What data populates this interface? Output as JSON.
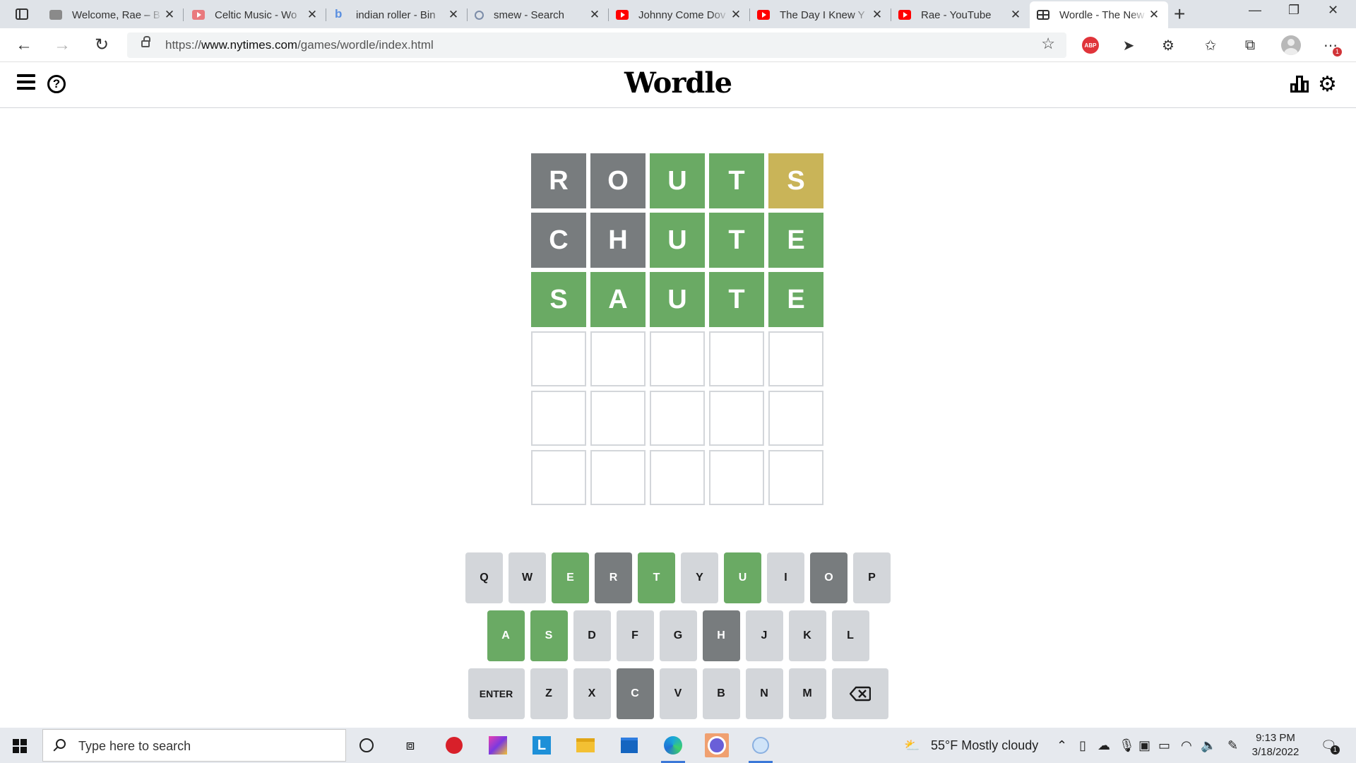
{
  "browser": {
    "tabs": [
      {
        "title": "Welcome, Rae – B",
        "favicon": "generic-site-icon"
      },
      {
        "title": "Celtic Music - Wo",
        "favicon": "youtube-icon"
      },
      {
        "title": "indian roller - Bin",
        "favicon": "bing-icon"
      },
      {
        "title": "smew - Search",
        "favicon": "search-icon"
      },
      {
        "title": "Johnny Come Dov",
        "favicon": "youtube-icon"
      },
      {
        "title": "The Day I Knew Y",
        "favicon": "youtube-icon"
      },
      {
        "title": "Rae - YouTube",
        "favicon": "youtube-icon"
      },
      {
        "title": "Wordle - The New",
        "favicon": "wordle-grid-icon"
      }
    ],
    "url_prefix": "https://",
    "url_domain": "www.nytimes.com",
    "url_path": "/games/wordle/index.html",
    "abp_label": "ABP",
    "notification_count": "1"
  },
  "wordle": {
    "title": "Wordle",
    "board": [
      [
        {
          "letter": "R",
          "state": "absent"
        },
        {
          "letter": "O",
          "state": "absent"
        },
        {
          "letter": "U",
          "state": "correct"
        },
        {
          "letter": "T",
          "state": "correct"
        },
        {
          "letter": "S",
          "state": "present"
        }
      ],
      [
        {
          "letter": "C",
          "state": "absent"
        },
        {
          "letter": "H",
          "state": "absent"
        },
        {
          "letter": "U",
          "state": "correct"
        },
        {
          "letter": "T",
          "state": "correct"
        },
        {
          "letter": "E",
          "state": "correct"
        }
      ],
      [
        {
          "letter": "S",
          "state": "correct"
        },
        {
          "letter": "A",
          "state": "correct"
        },
        {
          "letter": "U",
          "state": "correct"
        },
        {
          "letter": "T",
          "state": "correct"
        },
        {
          "letter": "E",
          "state": "correct"
        }
      ],
      [
        {
          "letter": "",
          "state": "empty"
        },
        {
          "letter": "",
          "state": "empty"
        },
        {
          "letter": "",
          "state": "empty"
        },
        {
          "letter": "",
          "state": "empty"
        },
        {
          "letter": "",
          "state": "empty"
        }
      ],
      [
        {
          "letter": "",
          "state": "empty"
        },
        {
          "letter": "",
          "state": "empty"
        },
        {
          "letter": "",
          "state": "empty"
        },
        {
          "letter": "",
          "state": "empty"
        },
        {
          "letter": "",
          "state": "empty"
        }
      ],
      [
        {
          "letter": "",
          "state": "empty"
        },
        {
          "letter": "",
          "state": "empty"
        },
        {
          "letter": "",
          "state": "empty"
        },
        {
          "letter": "",
          "state": "empty"
        },
        {
          "letter": "",
          "state": "empty"
        }
      ]
    ],
    "keyboard": [
      [
        {
          "label": "Q",
          "state": "unused"
        },
        {
          "label": "W",
          "state": "unused"
        },
        {
          "label": "E",
          "state": "correct"
        },
        {
          "label": "R",
          "state": "absent"
        },
        {
          "label": "T",
          "state": "correct"
        },
        {
          "label": "Y",
          "state": "unused"
        },
        {
          "label": "U",
          "state": "correct"
        },
        {
          "label": "I",
          "state": "unused"
        },
        {
          "label": "O",
          "state": "absent"
        },
        {
          "label": "P",
          "state": "unused"
        }
      ],
      [
        {
          "label": "A",
          "state": "correct"
        },
        {
          "label": "S",
          "state": "correct"
        },
        {
          "label": "D",
          "state": "unused"
        },
        {
          "label": "F",
          "state": "unused"
        },
        {
          "label": "G",
          "state": "unused"
        },
        {
          "label": "H",
          "state": "absent"
        },
        {
          "label": "J",
          "state": "unused"
        },
        {
          "label": "K",
          "state": "unused"
        },
        {
          "label": "L",
          "state": "unused"
        }
      ],
      [
        {
          "label": "ENTER",
          "state": "unused",
          "wide": true
        },
        {
          "label": "Z",
          "state": "unused"
        },
        {
          "label": "X",
          "state": "unused"
        },
        {
          "label": "C",
          "state": "absent"
        },
        {
          "label": "V",
          "state": "unused"
        },
        {
          "label": "B",
          "state": "unused"
        },
        {
          "label": "N",
          "state": "unused"
        },
        {
          "label": "M",
          "state": "unused"
        },
        {
          "label": "",
          "state": "unused",
          "wide": true,
          "icon": "backspace-icon"
        }
      ]
    ],
    "colors": {
      "correct": "#6aaa64",
      "present": "#c9b458",
      "absent": "#787c7e",
      "unused": "#d3d6da"
    }
  },
  "taskbar": {
    "search_placeholder": "Type here to search",
    "weather": "55°F  Mostly cloudy",
    "time": "9:13 PM",
    "date": "3/18/2022",
    "notification_count": "1"
  }
}
